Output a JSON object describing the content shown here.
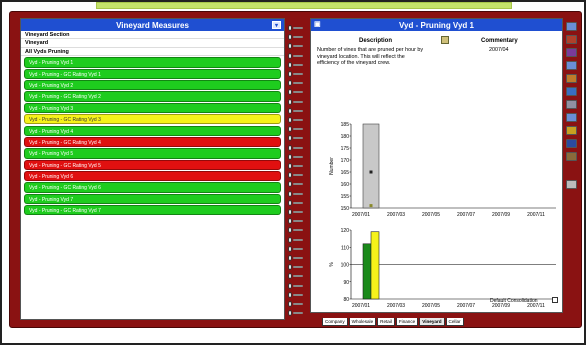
{
  "left_panel": {
    "title": "Vineyard Measures",
    "menu_btn": "▾",
    "section_label": "Vineyard Section",
    "vineyard_label": "Vineyard",
    "all_label": "All Vyds Pruning",
    "items": [
      {
        "label": "Vyd - Pruning Vyd 1",
        "status": "green"
      },
      {
        "label": "Vyd - Pruning - GC Rating Vyd 1",
        "status": "green"
      },
      {
        "label": "Vyd - Pruning Vyd 2",
        "status": "green"
      },
      {
        "label": "Vyd - Pruning - GC Rating Vyd 2",
        "status": "green"
      },
      {
        "label": "Vyd - Pruning Vyd 3",
        "status": "green"
      },
      {
        "label": "Vyd - Pruning - GC Rating Vyd 3",
        "status": "yellow"
      },
      {
        "label": "Vyd - Pruning Vyd 4",
        "status": "green"
      },
      {
        "label": "Vyd - Pruning - GC Rating Vyd 4",
        "status": "red"
      },
      {
        "label": "Vyd - Pruning Vyd 5",
        "status": "green"
      },
      {
        "label": "Vyd - Pruning - GC Rating Vyd 5",
        "status": "red"
      },
      {
        "label": "Vyd - Pruning Vyd 6",
        "status": "red"
      },
      {
        "label": "Vyd - Pruning - GC Rating Vyd 6",
        "status": "green"
      },
      {
        "label": "Vyd - Pruning Vyd 7",
        "status": "green"
      },
      {
        "label": "Vyd - Pruning - GC Rating Vyd 7",
        "status": "green"
      }
    ]
  },
  "right_panel": {
    "title": "Vyd - Pruning Vyd 1",
    "description_head": "Description",
    "commentary_head": "Commentary",
    "description": "Number of vines that are pruned per hour by vineyard location. This will reflect the efficiency of the vineyard crew.",
    "commentary_date": "2007/04",
    "consolidation_label": "Default Consolidation"
  },
  "tabs": [
    "Company",
    "Wholesale",
    "Retail",
    "Finance",
    "Vineyard",
    "Cellar"
  ],
  "colors": {
    "green": "#1ecc1e",
    "red": "#e01010",
    "yellow": "#f6f21a",
    "header": "#1f4fd1",
    "binder": "#8a1212"
  },
  "chart_data": [
    {
      "type": "bar",
      "ylabel": "Number",
      "x_ticks": [
        "2007/01",
        "2007/03",
        "2007/05",
        "2007/07",
        "2007/09",
        "2007/11"
      ],
      "ylim": [
        150,
        185
      ],
      "y_ticks": [
        150,
        155,
        160,
        165,
        170,
        175,
        180,
        185
      ],
      "values": [
        {
          "x": "2007/02",
          "value": 185,
          "marker_actual": 165,
          "marker_target": 151
        }
      ]
    },
    {
      "type": "bar",
      "ylabel": "%",
      "x_ticks": [
        "2007/01",
        "2007/03",
        "2007/05",
        "2007/07",
        "2007/09",
        "2007/11"
      ],
      "ylim": [
        80,
        120
      ],
      "y_ticks": [
        80,
        90,
        100,
        110,
        120
      ],
      "reference_line": 100,
      "series": [
        {
          "color": "#1b8a1b",
          "values": [
            112
          ]
        },
        {
          "color": "#f6f21a",
          "values": [
            119
          ]
        }
      ]
    }
  ]
}
